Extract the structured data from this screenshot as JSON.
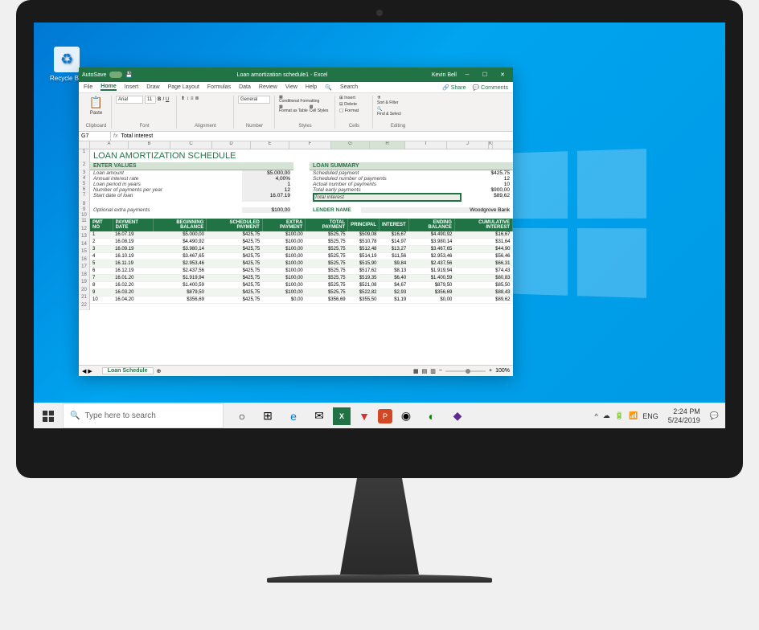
{
  "desktop": {
    "recycle_bin": "Recycle Bin"
  },
  "taskbar": {
    "search_placeholder": "Type here to search",
    "lang": "ENG",
    "time": "2:24 PM",
    "date": "5/24/2019"
  },
  "excel": {
    "autosave": "AutoSave",
    "title": "Loan amortization schedule1 - Excel",
    "user": "Kevin Bell",
    "tabs": [
      "File",
      "Home",
      "Insert",
      "Draw",
      "Page Layout",
      "Formulas",
      "Data",
      "Review",
      "View",
      "Help"
    ],
    "search": "Search",
    "share": "Share",
    "comments": "Comments",
    "ribbon": {
      "clipboard": {
        "paste": "Paste",
        "label": "Clipboard"
      },
      "font": {
        "name": "Arial",
        "size": "11",
        "label": "Font"
      },
      "alignment": {
        "label": "Alignment"
      },
      "number": {
        "format": "General",
        "label": "Number"
      },
      "styles": {
        "cf": "Conditional Formatting",
        "fat": "Format as Table",
        "cs": "Cell Styles",
        "label": "Styles"
      },
      "cells": {
        "insert": "Insert",
        "delete": "Delete",
        "format": "Format",
        "label": "Cells"
      },
      "editing": {
        "sort": "Sort & Filter",
        "find": "Find & Select",
        "label": "Editing"
      }
    },
    "name_box": "G7",
    "formula": "Total interest",
    "columns": [
      "A",
      "B",
      "C",
      "D",
      "E",
      "F",
      "G",
      "H",
      "I",
      "J",
      "K"
    ],
    "sheet": {
      "title": "LOAN AMORTIZATION SCHEDULE",
      "enter_values_header": "ENTER VALUES",
      "loan_summary_header": "LOAN SUMMARY",
      "enter_values": [
        {
          "label": "Loan amount",
          "value": "$5.000,00"
        },
        {
          "label": "Annual interest rate",
          "value": "4,00%"
        },
        {
          "label": "Loan period in years",
          "value": "1"
        },
        {
          "label": "Number of payments per year",
          "value": "12"
        },
        {
          "label": "Start date of loan",
          "value": "16.07.19"
        },
        {
          "label": "Optional extra payments",
          "value": "$100,00"
        }
      ],
      "loan_summary": [
        {
          "label": "Scheduled payment",
          "value": "$425,75"
        },
        {
          "label": "Scheduled number of payments",
          "value": "12"
        },
        {
          "label": "Actual number of payments",
          "value": "10"
        },
        {
          "label": "Total early payments",
          "value": "$900,00"
        },
        {
          "label": "Total interest",
          "value": "$89,62"
        }
      ],
      "lender_name_label": "LENDER NAME",
      "lender_name": "Woodgrove Bank",
      "table_headers": [
        "PMT NO",
        "PAYMENT DATE",
        "BEGINNING BALANCE",
        "SCHEDULED PAYMENT",
        "EXTRA PAYMENT",
        "TOTAL PAYMENT",
        "PRINCIPAL",
        "INTEREST",
        "ENDING BALANCE",
        "CUMULATIVE INTEREST"
      ],
      "table_rows": [
        [
          "1",
          "16.07.19",
          "$5.000,00",
          "$425,75",
          "$100,00",
          "$525,75",
          "$509,08",
          "$16,67",
          "$4.490,92",
          "$16,67"
        ],
        [
          "2",
          "16.08.19",
          "$4.490,92",
          "$425,75",
          "$100,00",
          "$525,75",
          "$510,78",
          "$14,97",
          "$3.980,14",
          "$31,64"
        ],
        [
          "3",
          "16.09.19",
          "$3.980,14",
          "$425,75",
          "$100,00",
          "$525,75",
          "$512,48",
          "$13,27",
          "$3.467,65",
          "$44,90"
        ],
        [
          "4",
          "16.10.19",
          "$3.467,65",
          "$425,75",
          "$100,00",
          "$525,75",
          "$514,19",
          "$11,56",
          "$2.953,46",
          "$56,46"
        ],
        [
          "5",
          "16.11.19",
          "$2.953,46",
          "$425,75",
          "$100,00",
          "$525,75",
          "$515,90",
          "$9,84",
          "$2.437,56",
          "$66,31"
        ],
        [
          "6",
          "16.12.19",
          "$2.437,56",
          "$425,75",
          "$100,00",
          "$525,75",
          "$517,62",
          "$8,13",
          "$1.919,94",
          "$74,43"
        ],
        [
          "7",
          "16.01.20",
          "$1.919,94",
          "$425,75",
          "$100,00",
          "$525,75",
          "$519,35",
          "$6,40",
          "$1.400,59",
          "$80,83"
        ],
        [
          "8",
          "16.02.20",
          "$1.400,59",
          "$425,75",
          "$100,00",
          "$525,75",
          "$521,08",
          "$4,67",
          "$879,50",
          "$85,50"
        ],
        [
          "9",
          "16.03.20",
          "$879,50",
          "$425,75",
          "$100,00",
          "$525,75",
          "$522,82",
          "$2,93",
          "$356,69",
          "$88,43"
        ],
        [
          "10",
          "16.04.20",
          "$356,69",
          "$425,75",
          "$0,00",
          "$356,69",
          "$355,50",
          "$1,19",
          "$0,00",
          "$89,62"
        ]
      ]
    },
    "sheet_tab": "Loan Schedule",
    "zoom": "100%"
  }
}
